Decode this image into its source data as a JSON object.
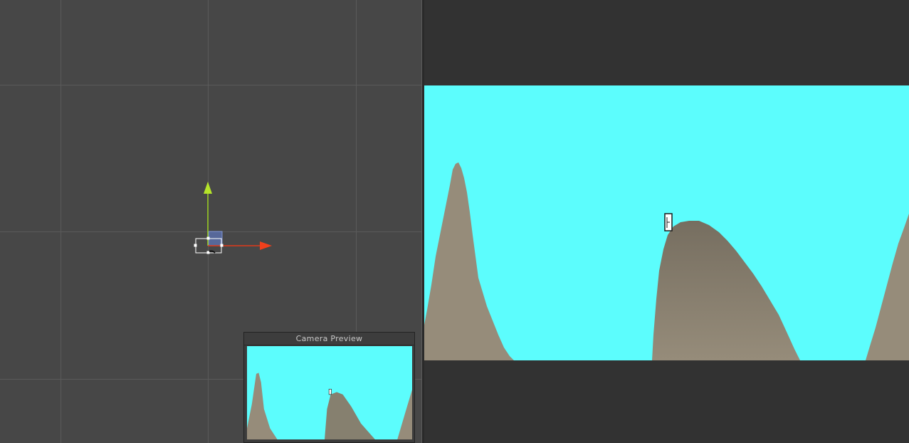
{
  "scene_view": {
    "icons": [
      "y-axis-arrow-icon",
      "x-axis-arrow-icon",
      "rect-transform-handles-icon",
      "camera-gizmo-icon"
    ],
    "colors": {
      "background": "#474747",
      "grid": "#5a5a5a",
      "y_axis": "#9bcf1e",
      "x_axis": "#e13a1b",
      "selection": "#6b82c7"
    }
  },
  "camera_preview": {
    "title": "Camera Preview"
  },
  "game_view": {
    "colors": {
      "sky": "#5cfdfd",
      "terrain": "#968c7a",
      "terrain_dark": "#766e60",
      "letterbox": "#323232"
    },
    "icons": [
      "player-sprite-icon"
    ]
  }
}
